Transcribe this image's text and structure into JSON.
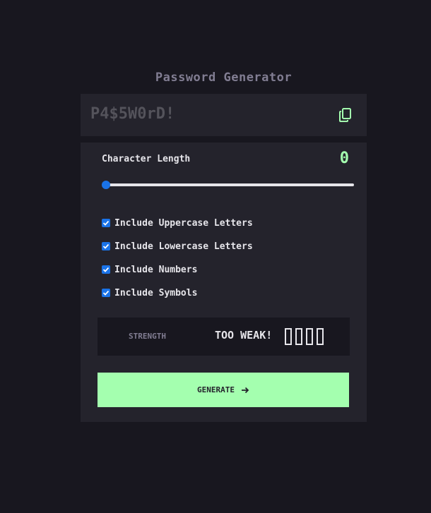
{
  "app": {
    "title": "Password Generator"
  },
  "output": {
    "password": "P4$5W0rD!",
    "copy_icon": "copy-icon"
  },
  "length": {
    "label": "Character Length",
    "value": "0",
    "slider_fraction": 0
  },
  "options": [
    {
      "label": "Include Uppercase Letters",
      "checked": true
    },
    {
      "label": "Include Lowercase Letters",
      "checked": true
    },
    {
      "label": "Include Numbers",
      "checked": true
    },
    {
      "label": "Include Symbols",
      "checked": true
    }
  ],
  "strength": {
    "label": "STRENGTH",
    "value": "TOO WEAK!",
    "filled_bars": 0,
    "total_bars": 4
  },
  "generate": {
    "label": "GENERATE",
    "icon": "arrow-right-icon"
  },
  "colors": {
    "background": "#18171f",
    "panel": "#24232c",
    "accent": "#a4ffaf",
    "text": "#e6e5ea",
    "muted": "#817d92",
    "checkbox": "#1a73e8"
  }
}
